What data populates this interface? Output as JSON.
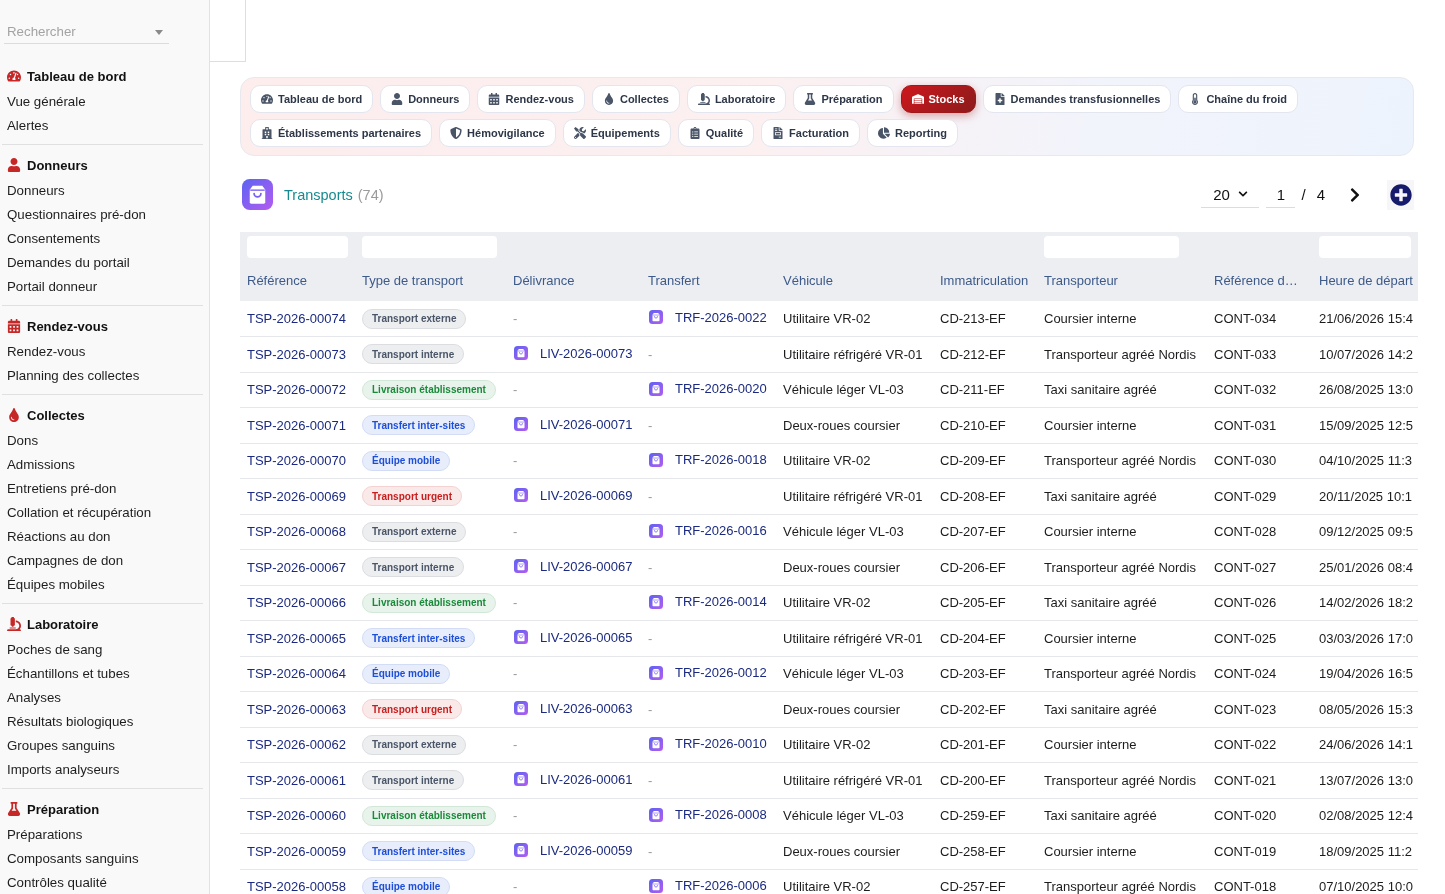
{
  "sidebar": {
    "search": {
      "placeholder": "Rechercher"
    },
    "groups": [
      {
        "title": "Tableau de bord",
        "items": [
          "Vue générale",
          "Alertes"
        ]
      },
      {
        "title": "Donneurs",
        "items": [
          "Donneurs",
          "Questionnaires pré-don",
          "Consentements",
          "Demandes du portail",
          "Portail donneur"
        ]
      },
      {
        "title": "Rendez-vous",
        "items": [
          "Rendez-vous",
          "Planning des collectes"
        ]
      },
      {
        "title": "Collectes",
        "items": [
          "Dons",
          "Admissions",
          "Entretiens pré-don",
          "Collation et récupération",
          "Réactions au don",
          "Campagnes de don",
          "Équipes mobiles"
        ]
      },
      {
        "title": "Laboratoire",
        "items": [
          "Poches de sang",
          "Échantillons et tubes",
          "Analyses",
          "Résultats biologiques",
          "Groupes sanguins",
          "Imports analyseurs"
        ]
      },
      {
        "title": "Préparation",
        "items": [
          "Préparations",
          "Composants sanguins",
          "Contrôles qualité"
        ]
      }
    ]
  },
  "nav": {
    "rows": [
      {
        "tabs": [
          {
            "label": "Tableau de bord",
            "selected": false
          },
          {
            "label": "Donneurs",
            "selected": false
          },
          {
            "label": "Rendez-vous",
            "selected": false
          },
          {
            "label": "Collectes",
            "selected": false
          },
          {
            "label": "Laboratoire",
            "selected": false
          },
          {
            "label": "Préparation",
            "selected": false
          },
          {
            "label": "Stocks",
            "selected": true
          },
          {
            "label": "Demandes transfusionnelles",
            "selected": false
          },
          {
            "label": "Chaîne du froid",
            "selected": false
          }
        ]
      },
      {
        "tabs": [
          {
            "label": "Établissements partenaires",
            "selected": false
          },
          {
            "label": "Hémovigilance",
            "selected": false
          },
          {
            "label": "Équipements",
            "selected": false
          },
          {
            "label": "Qualité",
            "selected": false
          },
          {
            "label": "Facturation",
            "selected": false
          },
          {
            "label": "Reporting",
            "selected": false
          }
        ]
      }
    ]
  },
  "header": {
    "title": "Transports",
    "count": "(74)",
    "page_size": "20",
    "page": "1",
    "separator": "/",
    "page_count": "4"
  },
  "table": {
    "columns": [
      {
        "label": "Référence",
        "filter": true
      },
      {
        "label": "Type de transport",
        "filter": true
      },
      {
        "label": "Délivrance",
        "filter": false
      },
      {
        "label": "Transfert",
        "filter": false
      },
      {
        "label": "Véhicule",
        "filter": false
      },
      {
        "label": "Immatriculation",
        "filter": false
      },
      {
        "label": "Transporteur",
        "filter": true
      },
      {
        "label": "Référence d…",
        "filter": false
      },
      {
        "label": "Heure de départ",
        "filter": true
      }
    ],
    "rows": [
      {
        "reference": "TSP-2026-00074",
        "type": {
          "label": "Transport externe",
          "color": "#4a5568"
        },
        "delivery": {
          "kind": "empty",
          "text": "-"
        },
        "transfer": {
          "kind": "link",
          "text": "TRF-2026-0022"
        },
        "vehicle": "Utilitaire VR-02",
        "plate": "CD-213-EF",
        "carrier": "Coursier interne",
        "column_8": "CONT-034",
        "departure": "21/06/2026 15:4"
      },
      {
        "reference": "TSP-2026-00073",
        "type": {
          "label": "Transport interne",
          "color": "#4a5568"
        },
        "delivery": {
          "kind": "link",
          "text": "LIV-2026-00073"
        },
        "transfer": {
          "kind": "empty",
          "text": "-"
        },
        "vehicle": "Utilitaire réfrigéré VR-01",
        "plate": "CD-212-EF",
        "carrier": "Transporteur agréé Nordis",
        "column_8": "CONT-033",
        "departure": "10/07/2026 14:2"
      },
      {
        "reference": "TSP-2026-00072",
        "type": {
          "label": "Livraison établissement",
          "color": "#1a8a3a"
        },
        "delivery": {
          "kind": "empty",
          "text": "-"
        },
        "transfer": {
          "kind": "link",
          "text": "TRF-2026-0020"
        },
        "vehicle": "Véhicule léger VL-03",
        "plate": "CD-211-EF",
        "carrier": "Taxi sanitaire agréé",
        "column_8": "CONT-032",
        "departure": "26/08/2025 13:0"
      },
      {
        "reference": "TSP-2026-00071",
        "type": {
          "label": "Transfert inter-sites",
          "color": "#1d4ed8"
        },
        "delivery": {
          "kind": "link",
          "text": "LIV-2026-00071"
        },
        "transfer": {
          "kind": "empty",
          "text": "-"
        },
        "vehicle": "Deux-roues coursier",
        "plate": "CD-210-EF",
        "carrier": "Coursier interne",
        "column_8": "CONT-031",
        "departure": "15/09/2025 12:5"
      },
      {
        "reference": "TSP-2026-00070",
        "type": {
          "label": "Équipe mobile",
          "color": "#1d4ed8"
        },
        "delivery": {
          "kind": "empty",
          "text": "-"
        },
        "transfer": {
          "kind": "link",
          "text": "TRF-2026-0018"
        },
        "vehicle": "Utilitaire VR-02",
        "plate": "CD-209-EF",
        "carrier": "Transporteur agréé Nordis",
        "column_8": "CONT-030",
        "departure": "04/10/2025 11:3"
      },
      {
        "reference": "TSP-2026-00069",
        "type": {
          "label": "Transport urgent",
          "color": "#c81e1e"
        },
        "delivery": {
          "kind": "link",
          "text": "LIV-2026-00069"
        },
        "transfer": {
          "kind": "empty",
          "text": "-"
        },
        "vehicle": "Utilitaire réfrigéré VR-01",
        "plate": "CD-208-EF",
        "carrier": "Taxi sanitaire agréé",
        "column_8": "CONT-029",
        "departure": "20/11/2025 10:1"
      },
      {
        "reference": "TSP-2026-00068",
        "type": {
          "label": "Transport externe",
          "color": "#4a5568"
        },
        "delivery": {
          "kind": "empty",
          "text": "-"
        },
        "transfer": {
          "kind": "link",
          "text": "TRF-2026-0016"
        },
        "vehicle": "Véhicule léger VL-03",
        "plate": "CD-207-EF",
        "carrier": "Coursier interne",
        "column_8": "CONT-028",
        "departure": "09/12/2025 09:5"
      },
      {
        "reference": "TSP-2026-00067",
        "type": {
          "label": "Transport interne",
          "color": "#4a5568"
        },
        "delivery": {
          "kind": "link",
          "text": "LIV-2026-00067"
        },
        "transfer": {
          "kind": "empty",
          "text": "-"
        },
        "vehicle": "Deux-roues coursier",
        "plate": "CD-206-EF",
        "carrier": "Transporteur agréé Nordis",
        "column_8": "CONT-027",
        "departure": "25/01/2026 08:4"
      },
      {
        "reference": "TSP-2026-00066",
        "type": {
          "label": "Livraison établissement",
          "color": "#1a8a3a"
        },
        "delivery": {
          "kind": "empty",
          "text": "-"
        },
        "transfer": {
          "kind": "link",
          "text": "TRF-2026-0014"
        },
        "vehicle": "Utilitaire VR-02",
        "plate": "CD-205-EF",
        "carrier": "Taxi sanitaire agréé",
        "column_8": "CONT-026",
        "departure": "14/02/2026 18:2"
      },
      {
        "reference": "TSP-2026-00065",
        "type": {
          "label": "Transfert inter-sites",
          "color": "#1d4ed8"
        },
        "delivery": {
          "kind": "link",
          "text": "LIV-2026-00065"
        },
        "transfer": {
          "kind": "empty",
          "text": "-"
        },
        "vehicle": "Utilitaire réfrigéré VR-01",
        "plate": "CD-204-EF",
        "carrier": "Coursier interne",
        "column_8": "CONT-025",
        "departure": "03/03/2026 17:0"
      },
      {
        "reference": "TSP-2026-00064",
        "type": {
          "label": "Équipe mobile",
          "color": "#1d4ed8"
        },
        "delivery": {
          "kind": "empty",
          "text": "-"
        },
        "transfer": {
          "kind": "link",
          "text": "TRF-2026-0012"
        },
        "vehicle": "Véhicule léger VL-03",
        "plate": "CD-203-EF",
        "carrier": "Transporteur agréé Nordis",
        "column_8": "CONT-024",
        "departure": "19/04/2026 16:5"
      },
      {
        "reference": "TSP-2026-00063",
        "type": {
          "label": "Transport urgent",
          "color": "#c81e1e"
        },
        "delivery": {
          "kind": "link",
          "text": "LIV-2026-00063"
        },
        "transfer": {
          "kind": "empty",
          "text": "-"
        },
        "vehicle": "Deux-roues coursier",
        "plate": "CD-202-EF",
        "carrier": "Taxi sanitaire agréé",
        "column_8": "CONT-023",
        "departure": "08/05/2026 15:3"
      },
      {
        "reference": "TSP-2026-00062",
        "type": {
          "label": "Transport externe",
          "color": "#4a5568"
        },
        "delivery": {
          "kind": "empty",
          "text": "-"
        },
        "transfer": {
          "kind": "link",
          "text": "TRF-2026-0010"
        },
        "vehicle": "Utilitaire VR-02",
        "plate": "CD-201-EF",
        "carrier": "Coursier interne",
        "column_8": "CONT-022",
        "departure": "24/06/2026 14:1"
      },
      {
        "reference": "TSP-2026-00061",
        "type": {
          "label": "Transport interne",
          "color": "#4a5568"
        },
        "delivery": {
          "kind": "link",
          "text": "LIV-2026-00061"
        },
        "transfer": {
          "kind": "empty",
          "text": "-"
        },
        "vehicle": "Utilitaire réfrigéré VR-01",
        "plate": "CD-200-EF",
        "carrier": "Transporteur agréé Nordis",
        "column_8": "CONT-021",
        "departure": "13/07/2026 13:0"
      },
      {
        "reference": "TSP-2026-00060",
        "type": {
          "label": "Livraison établissement",
          "color": "#1a8a3a"
        },
        "delivery": {
          "kind": "empty",
          "text": "-"
        },
        "transfer": {
          "kind": "link",
          "text": "TRF-2026-0008"
        },
        "vehicle": "Véhicule léger VL-03",
        "plate": "CD-259-EF",
        "carrier": "Taxi sanitaire agréé",
        "column_8": "CONT-020",
        "departure": "02/08/2025 12:4"
      },
      {
        "reference": "TSP-2026-00059",
        "type": {
          "label": "Transfert inter-sites",
          "color": "#1d4ed8"
        },
        "delivery": {
          "kind": "link",
          "text": "LIV-2026-00059"
        },
        "transfer": {
          "kind": "empty",
          "text": "-"
        },
        "vehicle": "Deux-roues coursier",
        "plate": "CD-258-EF",
        "carrier": "Coursier interne",
        "column_8": "CONT-019",
        "departure": "18/09/2025 11:2"
      },
      {
        "reference": "TSP-2026-00058",
        "type": {
          "label": "Équipe mobile",
          "color": "#1d4ed8"
        },
        "delivery": {
          "kind": "empty",
          "text": "-"
        },
        "transfer": {
          "kind": "link",
          "text": "TRF-2026-0006"
        },
        "vehicle": "Utilitaire VR-02",
        "plate": "CD-257-EF",
        "carrier": "Transporteur agréé Nordis",
        "column_8": "CONT-018",
        "departure": "07/10/2025 10:0"
      }
    ]
  }
}
